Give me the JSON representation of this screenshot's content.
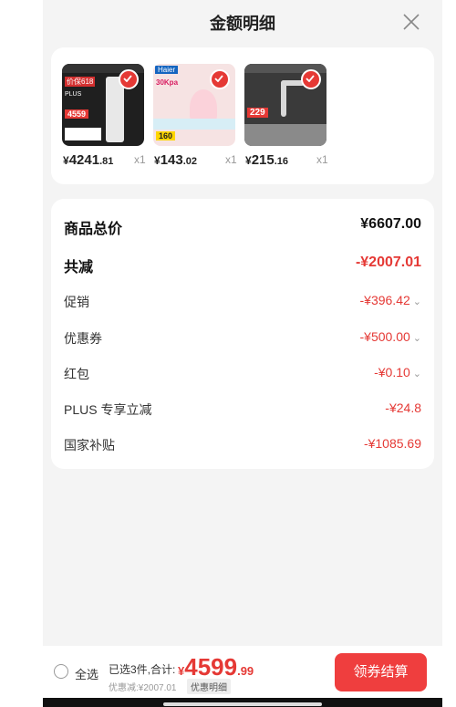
{
  "header": {
    "title": "金额明细"
  },
  "products": [
    {
      "price_yen": "¥",
      "price_int": "4241",
      "price_dec": ".81",
      "qty": "x1",
      "thumb_icon": "air-conditioner-product-image",
      "thumb_labels": [
        "价保618",
        "PLUS",
        "4559"
      ]
    },
    {
      "price_yen": "¥",
      "price_int": "143",
      "price_dec": ".02",
      "qty": "x1",
      "thumb_icon": "hair-dryer-product-image",
      "thumb_labels": [
        "Haier",
        "30Kpa",
        "160"
      ]
    },
    {
      "price_yen": "¥",
      "price_int": "215",
      "price_dec": ".16",
      "qty": "x1",
      "thumb_icon": "faucet-product-image",
      "thumb_labels": [
        "229"
      ]
    }
  ],
  "summary": {
    "rows": [
      {
        "label": "商品总价",
        "value": "¥6607.00"
      },
      {
        "label": "共减",
        "value": "-¥2007.01"
      },
      {
        "label": "促销",
        "value": "-¥396.42"
      },
      {
        "label": "优惠券",
        "value": "-¥500.00"
      },
      {
        "label": "红包",
        "value": "-¥0.10"
      },
      {
        "label": "PLUS 专享立减",
        "value": "-¥24.8"
      },
      {
        "label": "国家补贴",
        "value": "-¥1085.69"
      }
    ],
    "chevron": "⌄"
  },
  "bottom": {
    "select_all": "全选",
    "selected_text": "已选3件,合计:",
    "total_yen": "¥",
    "total_int": "4599",
    "total_dec": ".99",
    "discount_text": "优惠减:¥2007.01",
    "detail_link": "优惠明细",
    "checkout": "领券结算"
  },
  "colors": {
    "accent": "#e53935",
    "checkout_bg": "#ef3e3e",
    "panel_bg": "#f4f4f4"
  }
}
